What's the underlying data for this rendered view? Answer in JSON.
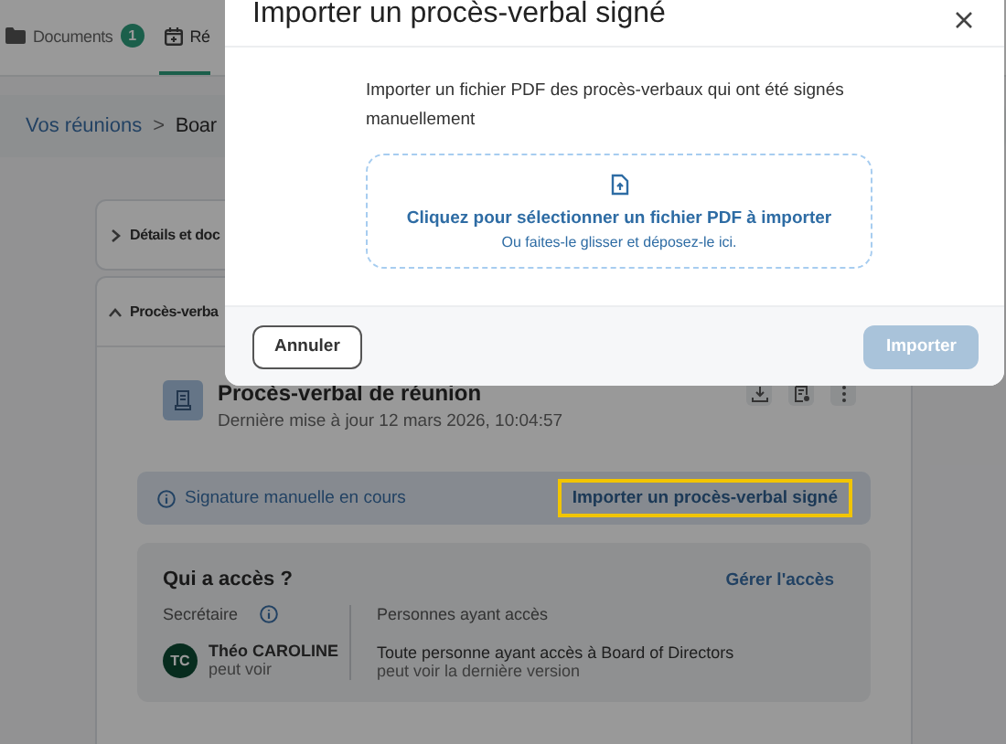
{
  "tabs": [
    {
      "label": "Documents",
      "badge": "1",
      "selected": false
    },
    {
      "label": "Ré",
      "selected": true
    }
  ],
  "breadcrumb": {
    "items": [
      {
        "label": "Vos réunions",
        "link": true
      },
      {
        "label": "Boar",
        "link": false
      }
    ],
    "separator": ">"
  },
  "sections": [
    {
      "title": "Détails et doc",
      "expanded": false
    },
    {
      "title": "Procès-verba",
      "expanded": true
    }
  ],
  "document": {
    "title": "Procès-verbal de réunion",
    "updated": "Dernière mise à jour 12 mars 2026, 10:04:57"
  },
  "banner": {
    "status": "Signature manuelle en cours",
    "action": "Importer un procès-verbal signé",
    "highlighted": true
  },
  "access": {
    "title": "Qui a accès ?",
    "manage": "Gérer l'accès",
    "secretary_label": "Secrétaire",
    "secretary": {
      "initials": "TC",
      "name": "Théo CAROLINE",
      "role": "peut voir"
    },
    "people_label": "Personnes ayant accès",
    "people_text": "Toute personne ayant accès à Board of Directors",
    "people_sub": "peut voir la dernière version"
  },
  "dialog": {
    "title": "Importer un procès-verbal signé",
    "description": "Importer un fichier PDF des procès-verbaux qui ont été signés manuellement",
    "dropzone": {
      "primary": "Cliquez pour sélectionner un fichier PDF à importer",
      "secondary": "Ou faites-le glisser et déposez-le ici."
    },
    "buttons": [
      {
        "label": "Annuler",
        "kind": "secondary",
        "disabled": false
      },
      {
        "label": "Importer",
        "kind": "primary",
        "disabled": true
      }
    ]
  }
}
